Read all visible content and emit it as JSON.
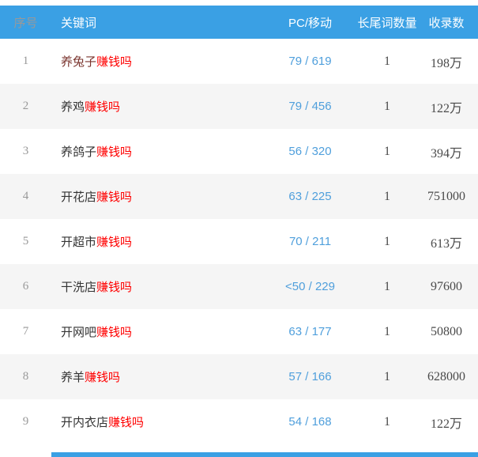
{
  "colors": {
    "header_bg": "#3aa0e4",
    "header_text": "#ffffff",
    "alt_row_bg": "#f5f5f5",
    "highlight_red": "#ff0000",
    "pc_link_blue": "#4f9fdc",
    "index_gray": "#999999",
    "value_gray": "#4a4a4a",
    "keyword_dark": "#333333"
  },
  "table": {
    "columns": [
      {
        "label": "序号"
      },
      {
        "label": "关键词"
      },
      {
        "label": "PC/移动"
      },
      {
        "label": "长尾词数量"
      },
      {
        "label": "收录数"
      }
    ],
    "rows": [
      {
        "index": "1",
        "keyword_prefix": "养兔子",
        "keyword_highlight": "赚钱吗",
        "prefix_color": "#7a342e",
        "pc_mobile": "79 / 619",
        "longtail_count": "1",
        "collect_count": "198万"
      },
      {
        "index": "2",
        "keyword_prefix": "养鸡",
        "keyword_highlight": "赚钱吗",
        "pc_mobile": "79 / 456",
        "longtail_count": "1",
        "collect_count": "122万"
      },
      {
        "index": "3",
        "keyword_prefix": "养鸽子",
        "keyword_highlight": "赚钱吗",
        "pc_mobile": "56 / 320",
        "longtail_count": "1",
        "collect_count": "394万"
      },
      {
        "index": "4",
        "keyword_prefix": "开花店",
        "keyword_highlight": "赚钱吗",
        "pc_mobile": "63 / 225",
        "longtail_count": "1",
        "collect_count": "751000"
      },
      {
        "index": "5",
        "keyword_prefix": "开超市",
        "keyword_highlight": "赚钱吗",
        "pc_mobile": "70 / 211",
        "longtail_count": "1",
        "collect_count": "613万"
      },
      {
        "index": "6",
        "keyword_prefix": "干洗店",
        "keyword_highlight": "赚钱吗",
        "pc_mobile": "<50 / 229",
        "longtail_count": "1",
        "collect_count": "97600"
      },
      {
        "index": "7",
        "keyword_prefix": "开网吧",
        "keyword_highlight": "赚钱吗",
        "pc_mobile": "63 / 177",
        "longtail_count": "1",
        "collect_count": "50800"
      },
      {
        "index": "8",
        "keyword_prefix": "养羊",
        "keyword_highlight": "赚钱吗",
        "pc_mobile": "57 / 166",
        "longtail_count": "1",
        "collect_count": "628000"
      },
      {
        "index": "9",
        "keyword_prefix": "开内衣店",
        "keyword_highlight": "赚钱吗",
        "pc_mobile": "54 / 168",
        "longtail_count": "1",
        "collect_count": "122万"
      }
    ]
  }
}
